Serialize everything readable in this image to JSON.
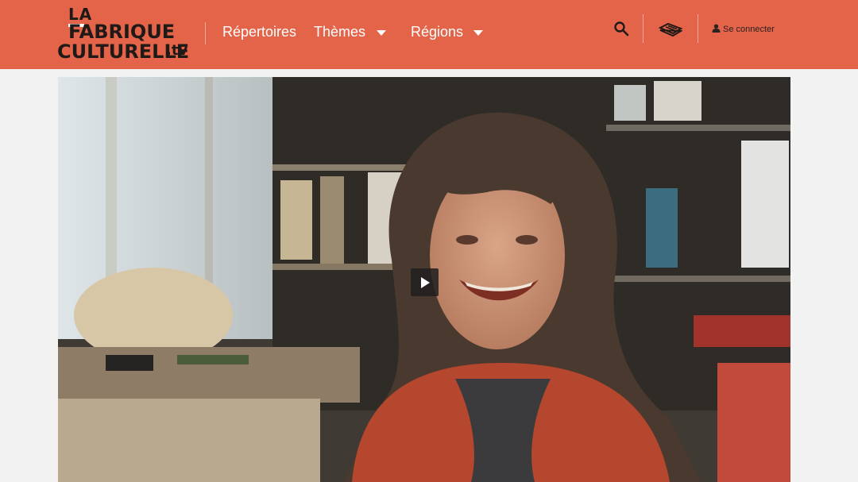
{
  "header": {
    "logo": {
      "line1": "LA",
      "line2": "FABRIQUE",
      "line3": "CULTURELLE",
      "suffix": ".tv"
    },
    "nav": [
      {
        "label": "Répertoires",
        "has_dropdown": false
      },
      {
        "label": "Thèmes",
        "has_dropdown": true
      },
      {
        "label": "Régions",
        "has_dropdown": true
      }
    ],
    "search_icon": "search-icon",
    "tray_icon": "tray-icon",
    "login": {
      "icon": "user-icon",
      "label": "Se connecter"
    }
  },
  "video": {
    "play_icon": "play-icon"
  },
  "colors": {
    "header_bg": "#e4644a",
    "page_bg": "#f2f2f2",
    "nav_text": "#ffffff",
    "dark_text": "#1f1a17"
  }
}
